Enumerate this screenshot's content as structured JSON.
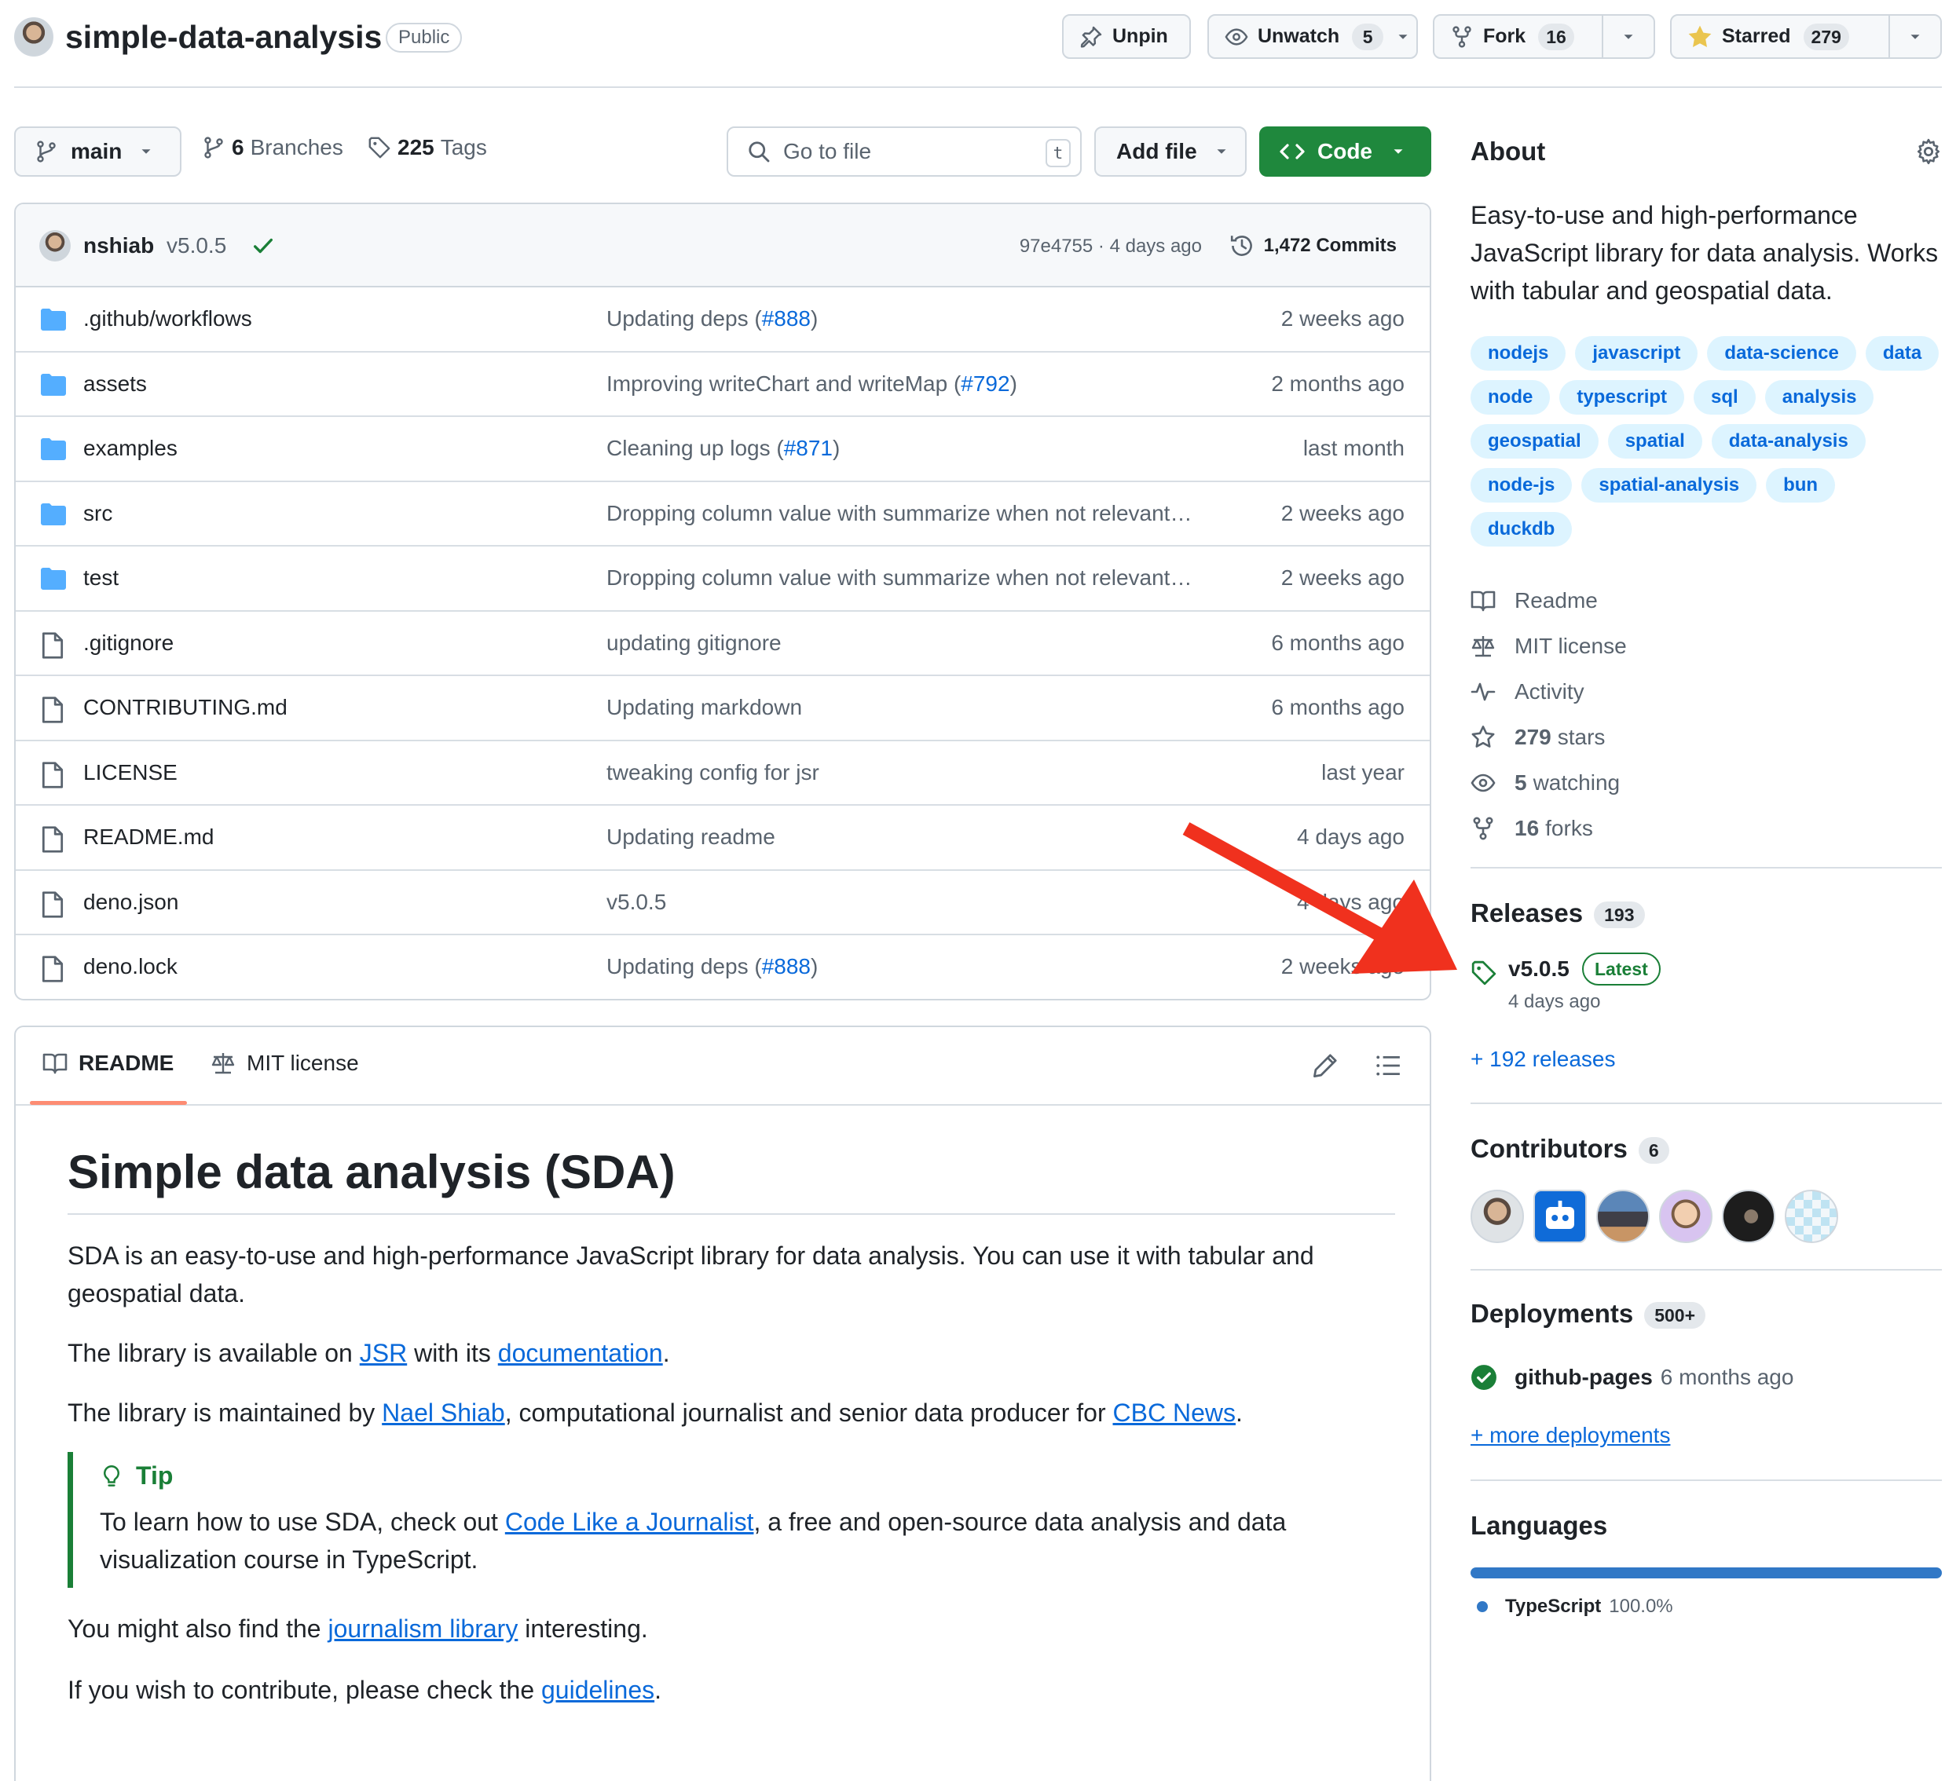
{
  "repo": {
    "name": "simple-data-analysis",
    "visibility": "Public"
  },
  "header_actions": {
    "unpin": "Unpin",
    "unwatch": "Unwatch",
    "watch_count": "5",
    "fork": "Fork",
    "fork_count": "16",
    "starred": "Starred",
    "star_count": "279"
  },
  "toolbar": {
    "branch": "main",
    "branches_count": "6",
    "branches_label": "Branches",
    "tags_count": "225",
    "tags_label": "Tags",
    "search_placeholder": "Go to file",
    "search_key": "t",
    "add_file": "Add file",
    "code": "Code"
  },
  "latest_commit": {
    "author": "nshiab",
    "message": "v5.0.5",
    "hash_time": "97e4755 · 4 days ago",
    "commits": "1,472 Commits"
  },
  "files": [
    {
      "name": ".github/workflows",
      "type": "folder",
      "msg": "Updating deps (",
      "pr": "#888",
      "msg_end": ")",
      "date": "2 weeks ago"
    },
    {
      "name": "assets",
      "type": "folder",
      "msg": "Improving writeChart and writeMap (",
      "pr": "#792",
      "msg_end": ")",
      "date": "2 months ago"
    },
    {
      "name": "examples",
      "type": "folder",
      "msg": "Cleaning up logs (",
      "pr": "#871",
      "msg_end": ")",
      "date": "last month"
    },
    {
      "name": "src",
      "type": "folder",
      "msg": "Dropping column value with summarize when not relevant…",
      "pr": "",
      "msg_end": "",
      "date": "2 weeks ago"
    },
    {
      "name": "test",
      "type": "folder",
      "msg": "Dropping column value with summarize when not relevant…",
      "pr": "",
      "msg_end": "",
      "date": "2 weeks ago"
    },
    {
      "name": ".gitignore",
      "type": "file",
      "msg": "updating gitignore",
      "pr": "",
      "msg_end": "",
      "date": "6 months ago"
    },
    {
      "name": "CONTRIBUTING.md",
      "type": "file",
      "msg": "Updating markdown",
      "pr": "",
      "msg_end": "",
      "date": "6 months ago"
    },
    {
      "name": "LICENSE",
      "type": "file",
      "msg": "tweaking config for jsr",
      "pr": "",
      "msg_end": "",
      "date": "last year"
    },
    {
      "name": "README.md",
      "type": "file",
      "msg": "Updating readme",
      "pr": "",
      "msg_end": "",
      "date": "4 days ago"
    },
    {
      "name": "deno.json",
      "type": "file",
      "msg": "v5.0.5",
      "pr": "",
      "msg_end": "",
      "date": "4 days ago"
    },
    {
      "name": "deno.lock",
      "type": "file",
      "msg": "Updating deps (",
      "pr": "#888",
      "msg_end": ")",
      "date": "2 weeks ago"
    }
  ],
  "readme": {
    "tab_readme": "README",
    "tab_license": "MIT license",
    "title": "Simple data analysis (SDA)",
    "p1": "SDA is an easy-to-use and high-performance JavaScript library for data analysis. You can use it with tabular and geospatial data.",
    "p2_a": "The library is available on ",
    "p2_link1": "JSR",
    "p2_b": " with its ",
    "p2_link2": "documentation",
    "p2_c": ".",
    "p3_a": "The library is maintained by ",
    "p3_link1": "Nael Shiab",
    "p3_b": ", computational journalist and senior data producer for ",
    "p3_link2": "CBC News",
    "p3_c": ".",
    "tip_title": "Tip",
    "tip_a": "To learn how to use SDA, check out ",
    "tip_link": "Code Like a Journalist",
    "tip_b": ", a free and open-source data analysis and data visualization course in TypeScript.",
    "p4_a": "You might also find the ",
    "p4_link": "journalism library",
    "p4_b": " interesting.",
    "p5_a": "If you wish to contribute, please check the ",
    "p5_link": "guidelines",
    "p5_b": "."
  },
  "about": {
    "title": "About",
    "description": "Easy-to-use and high-performance JavaScript library for data analysis. Works with tabular and geospatial data.",
    "topics": [
      "nodejs",
      "javascript",
      "data-science",
      "data",
      "node",
      "typescript",
      "sql",
      "analysis",
      "geospatial",
      "spatial",
      "data-analysis",
      "node-js",
      "spatial-analysis",
      "bun",
      "duckdb"
    ],
    "readme": "Readme",
    "license": "MIT license",
    "activity": "Activity",
    "stars_n": "279",
    "stars": "stars",
    "watching_n": "5",
    "watching": "watching",
    "forks_n": "16",
    "forks": "forks"
  },
  "releases": {
    "title": "Releases",
    "count": "193",
    "latest_name": "v5.0.5",
    "latest_badge": "Latest",
    "latest_date": "4 days ago",
    "more": "+ 192 releases"
  },
  "contributors": {
    "title": "Contributors",
    "count": "6"
  },
  "deployments": {
    "title": "Deployments",
    "count": "500+",
    "env": "github-pages",
    "time": "6 months ago",
    "more": "+ more deployments"
  },
  "languages": {
    "title": "Languages",
    "name": "TypeScript",
    "percent": "100.0%",
    "share": 1.0,
    "color": "#3178c6"
  },
  "colors": {
    "accent": "#0969da",
    "green": "#1f883d",
    "annotation_arrow": "#f0311e"
  }
}
